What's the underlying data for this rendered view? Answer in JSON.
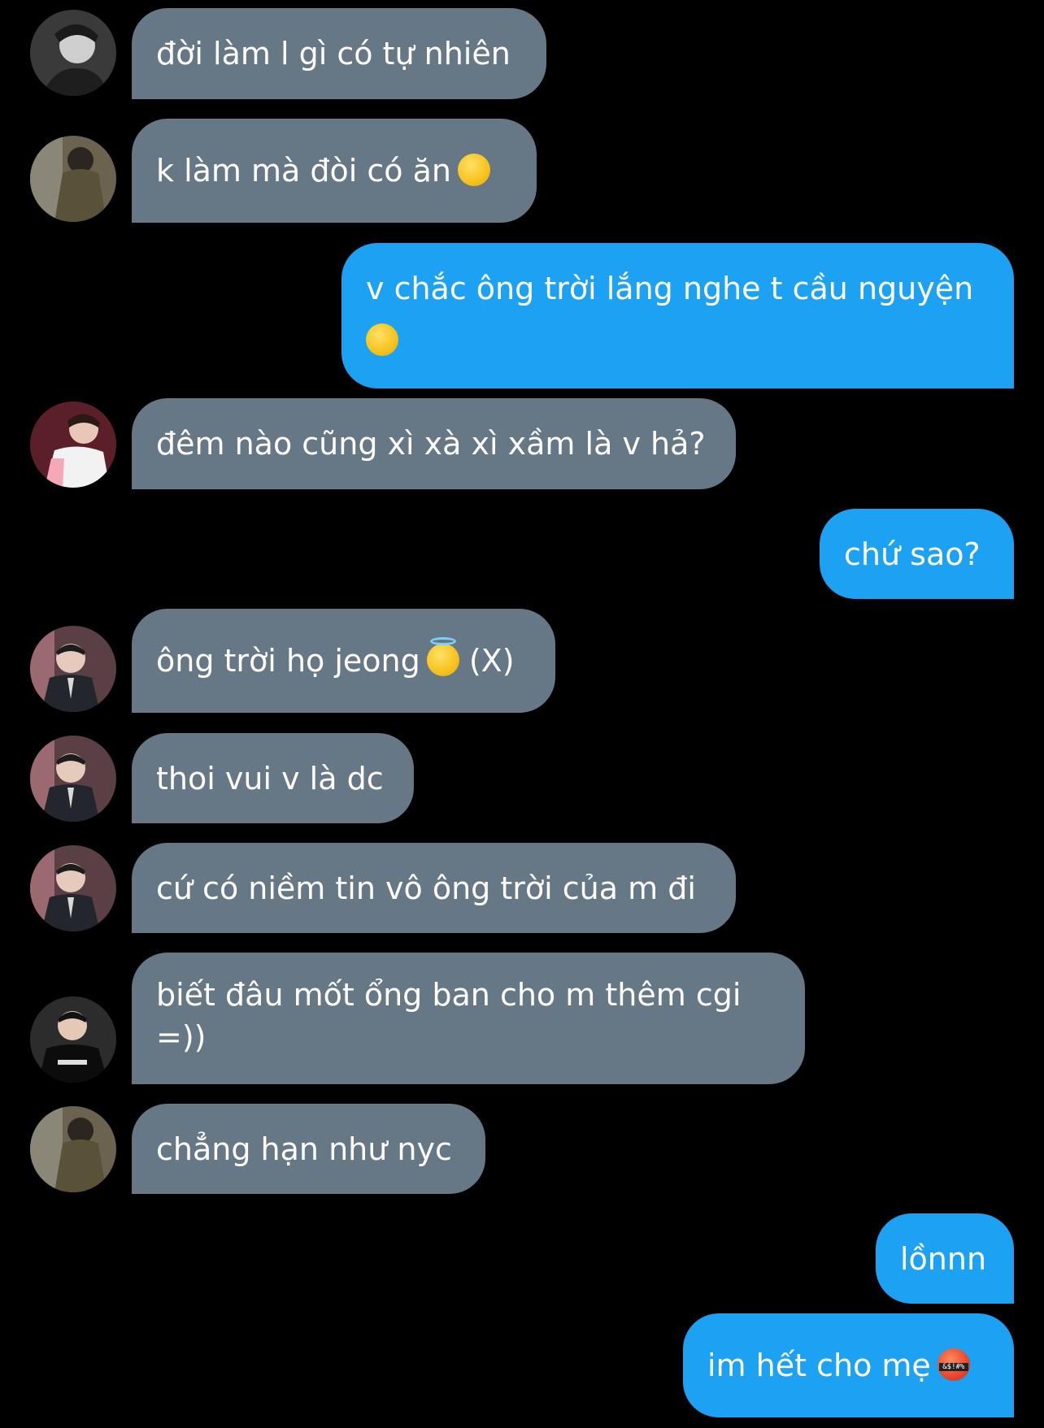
{
  "colors": {
    "background": "#000000",
    "received_bubble": "#667786",
    "sent_bubble": "#1DA1F2",
    "text": "#ffffff"
  },
  "messages": [
    {
      "sender": "other",
      "text": "đời làm l gì có tự nhiên",
      "avatar": "avatar-bw-portrait"
    },
    {
      "sender": "other",
      "text": "k làm mà đòi có ăn",
      "emoji": "kissing-face-icon",
      "avatar": "avatar-jacket-street"
    },
    {
      "sender": "me",
      "text": "v chắc ông trời lắng nghe t cầu nguyện",
      "emoji": "smiling-face-icon"
    },
    {
      "sender": "other",
      "text": "đêm nào cũng xì xà xì xầm là v hả?",
      "avatar": "avatar-pink-jacket"
    },
    {
      "sender": "me",
      "text": "chứ sao?"
    },
    {
      "sender": "other",
      "text": "ông trời họ jeong",
      "emoji": "halo-face-icon",
      "suffix": "(X)",
      "avatar": "avatar-suit-glasses"
    },
    {
      "sender": "other",
      "text": "thoi vui v là dc",
      "avatar": "avatar-suit-glasses"
    },
    {
      "sender": "other",
      "text": "cứ có niềm tin vô ông trời của m đi",
      "avatar": "avatar-suit-glasses"
    },
    {
      "sender": "other",
      "text": "biết đâu mốt ổng ban cho m thêm cgi =))",
      "avatar": "avatar-pascal-shirt"
    },
    {
      "sender": "other",
      "text": "chẳng hạn như nyc",
      "avatar": "avatar-jacket-street"
    },
    {
      "sender": "me",
      "text": "lồnnn"
    },
    {
      "sender": "me",
      "text": "im hết cho mẹ",
      "emoji": "cursing-face-icon"
    }
  ]
}
